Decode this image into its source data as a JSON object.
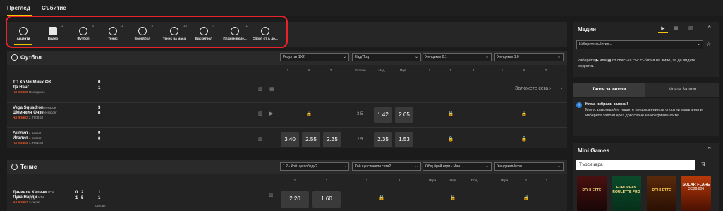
{
  "topnav": {
    "tabs": [
      {
        "label": "Преглед"
      },
      {
        "label": "Събитие"
      }
    ]
  },
  "sports": [
    {
      "label": "Акценти",
      "count": "",
      "icon": "highlights-icon"
    },
    {
      "label": "Видео",
      "count": "11",
      "icon": "video-icon"
    },
    {
      "label": "Футбол",
      "count": "3",
      "icon": "football-icon"
    },
    {
      "label": "Тенис",
      "count": "11",
      "icon": "tennis-icon"
    },
    {
      "label": "Волейбол",
      "count": "8",
      "icon": "volleyball-icon"
    },
    {
      "label": "Тенис на маса",
      "count": "15",
      "icon": "table-tennis-icon"
    },
    {
      "label": "Баскетбол",
      "count": "4",
      "icon": "basketball-icon"
    },
    {
      "label": "Плажен воле...",
      "count": "1",
      "icon": "beach-volleyball-icon"
    },
    {
      "label": "Спорт от А до...",
      "count": "",
      "icon": "sports-az-icon"
    }
  ],
  "football": {
    "title": "Футбол",
    "dropdowns": [
      "Резултат 1Х2",
      "Над/Под",
      "Хендикап 0:1",
      "Хендикап 1:0"
    ],
    "cols1": [
      "1",
      "X",
      "2"
    ],
    "cols2": [
      "Голове",
      "Над",
      "Под"
    ],
    "cols3": [
      "1",
      "X",
      "2"
    ],
    "cols4": [
      "1",
      "X",
      "2"
    ],
    "bet_now": "Заложете сега",
    "matches": [
      {
        "team1": "ТП Хо Чи Минх ФК",
        "team1_tag": "",
        "team2": "Да Нанг",
        "team2_tag": "",
        "s1": "0",
        "s2": "1",
        "live": "НА ЖИВО",
        "meta": "Полувреме"
      },
      {
        "team1": "Vega Squadron",
        "team1_tag": "e-soccer",
        "team2": "Шемякин Онзе",
        "team2_tag": "e-soccer",
        "s1": "3",
        "s2": "0",
        "live": "НА ЖИВО",
        "meta": "2. П 08:52",
        "line": "3,5",
        "o_over": "1.42",
        "o_under": "2.65"
      },
      {
        "team1": "Англия",
        "team1_tag": "e-soccer",
        "team2": "Италия",
        "team2_tag": "e-soccer",
        "s1": "0",
        "s2": "0",
        "live": "НА ЖИВО",
        "meta": "1. П 01:48",
        "o1": "3.40",
        "ox": "2.55",
        "o2": "2.35",
        "line": "2,5",
        "o_over": "2.35",
        "o_under": "1.53"
      }
    ]
  },
  "tennis": {
    "title": "Тенис",
    "dropdowns": [
      "1 2 - Кой ще победи?",
      "Кой ще спечели сета?",
      "Общ брой игри - Мач",
      "Хендикап/Игри"
    ],
    "cols1": [
      "1",
      "2"
    ],
    "cols2": [
      "1",
      "2"
    ],
    "cols3": [
      "Игри",
      "Над",
      "Под"
    ],
    "cols4": [
      "Игри",
      "1",
      "2"
    ],
    "match": {
      "p1": "Даниеле Капечи",
      "p1_tag": "ИТА",
      "p2": "Лука Нарди",
      "p2_tag": "ИТА",
      "sets1": "0",
      "games1": "2",
      "pts1": "1",
      "sets2": "1",
      "games2": "5",
      "pts2": "1",
      "live": "НА ЖИВО",
      "meta": "3-ти сет",
      "o1": "2.20",
      "o2": "1.60",
      "extra": "Сетове"
    }
  },
  "media": {
    "title": "Медии",
    "select_placeholder": "Изберете събитие...",
    "text1": "Изберете",
    "text2": "или",
    "text3": "от списъка със събития на живо, за да видите медията."
  },
  "betslip": {
    "tab1": "Талон за залози",
    "tab2": "Моите Залози",
    "title": "Няма избрани залози!",
    "text": "Моля, разгледайте нашите предложения за спортни залагания и изберете залози чрез докосване на коефициентите."
  },
  "minigames": {
    "title": "Mini Games",
    "search_placeholder": "Търси игра",
    "games": [
      {
        "name": "ROULETTE"
      },
      {
        "name": "EUROPEAN ROULETTE PRO"
      },
      {
        "name": "ROULETTE"
      },
      {
        "name": "SOLAR FLARE",
        "amount": "3,329,806"
      }
    ]
  },
  "colors": {
    "accent": "#f5c400",
    "highlight_box": "#e8232a",
    "live": "#e85a2a"
  }
}
